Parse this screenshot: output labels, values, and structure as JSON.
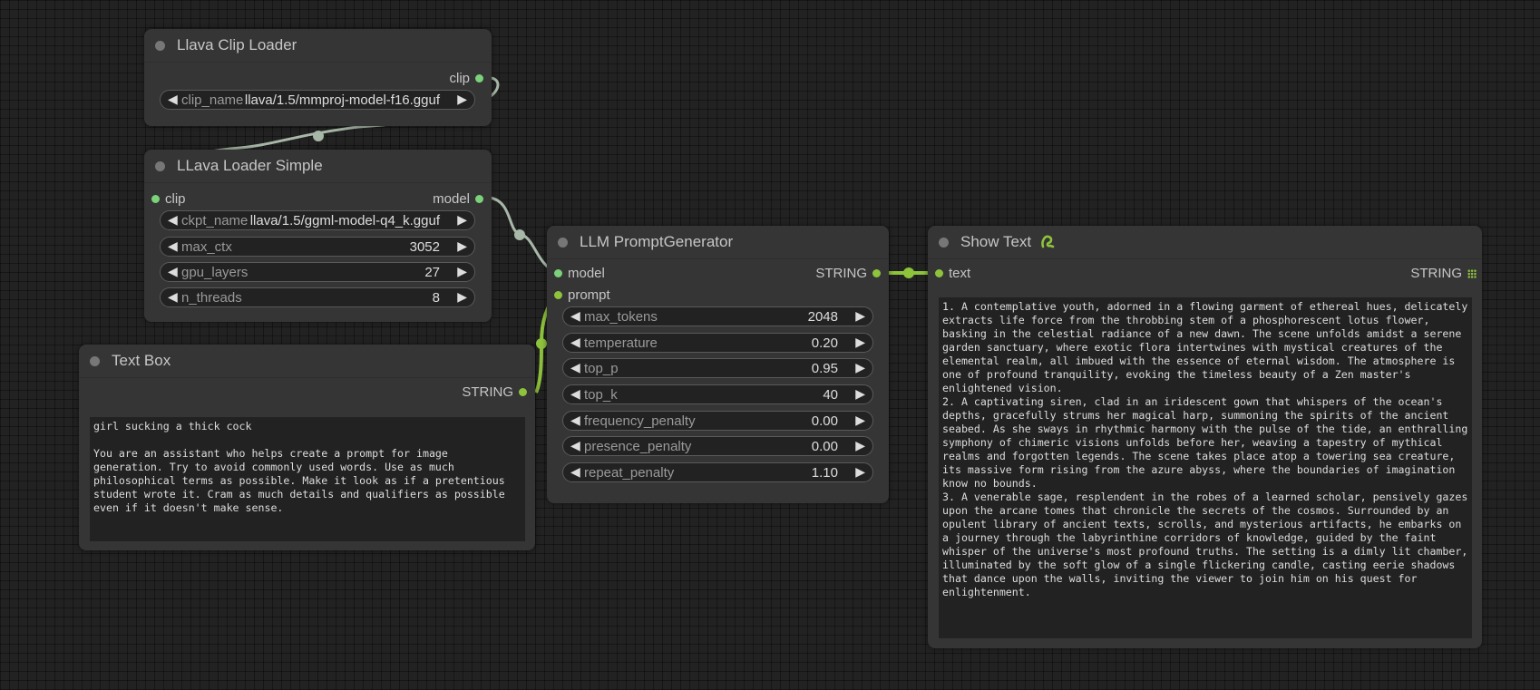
{
  "nodes": {
    "clip_loader": {
      "title": "Llava Clip Loader",
      "output": "clip",
      "widgets": [
        {
          "name": "clip_name",
          "value": "llava/1.5/mmproj-model-f16.gguf"
        }
      ]
    },
    "loader_simple": {
      "title": "LLava Loader Simple",
      "input": "clip",
      "output": "model",
      "widgets": [
        {
          "name": "ckpt_name",
          "value": "llava/1.5/ggml-model-q4_k.gguf"
        },
        {
          "name": "max_ctx",
          "value": "3052"
        },
        {
          "name": "gpu_layers",
          "value": "27"
        },
        {
          "name": "n_threads",
          "value": "8"
        }
      ]
    },
    "text_box": {
      "title": "Text Box",
      "output": "STRING",
      "text": "girl sucking a thick cock\n\nYou are an assistant who helps create a prompt for image generation. Try to avoid commonly used words. Use as much philosophical terms as possible. Make it look as if a pretentious student wrote it. Cram as much details and qualifiers as possible even if it doesn't make sense."
    },
    "prompt_generator": {
      "title": "LLM PromptGenerator",
      "inputs": [
        "model",
        "prompt"
      ],
      "output": "STRING",
      "widgets": [
        {
          "name": "max_tokens",
          "value": "2048"
        },
        {
          "name": "temperature",
          "value": "0.20"
        },
        {
          "name": "top_p",
          "value": "0.95"
        },
        {
          "name": "top_k",
          "value": "40"
        },
        {
          "name": "frequency_penalty",
          "value": "0.00"
        },
        {
          "name": "presence_penalty",
          "value": "0.00"
        },
        {
          "name": "repeat_penalty",
          "value": "1.10"
        }
      ]
    },
    "show_text": {
      "title": "Show Text",
      "input": "text",
      "output": "STRING",
      "text": "1. A contemplative youth, adorned in a flowing garment of ethereal hues, delicately extracts life force from the throbbing stem of a phosphorescent lotus flower, basking in the celestial radiance of a new dawn. The scene unfolds amidst a serene garden sanctuary, where exotic flora intertwines with mystical creatures of the elemental realm, all imbued with the essence of eternal wisdom. The atmosphere is one of profound tranquility, evoking the timeless beauty of a Zen master's enlightened vision.\n2. A captivating siren, clad in an iridescent gown that whispers of the ocean's depths, gracefully strums her magical harp, summoning the spirits of the ancient seabed. As she sways in rhythmic harmony with the pulse of the tide, an enthralling symphony of chimeric visions unfolds before her, weaving a tapestry of mythical realms and forgotten legends. The scene takes place atop a towering sea creature, its massive form rising from the azure abyss, where the boundaries of imagination know no bounds.\n3. A venerable sage, resplendent in the robes of a learned scholar, pensively gazes upon the arcane tomes that chronicle the secrets of the cosmos. Surrounded by an opulent library of ancient texts, scrolls, and mysterious artifacts, he embarks on a journey through the labyrinthine corridors of knowledge, guided by the faint whisper of the universe's most profound truths. The setting is a dimly lit chamber, illuminated by the soft glow of a single flickering candle, casting eerie shadows that dance upon the walls, inviting the viewer to join him on his quest for enlightenment."
    }
  },
  "colors": {
    "canvas": "#222222",
    "node": "#353535",
    "clip_link": "#a8b8a8",
    "string_link": "#8ec33c",
    "model_slot": "#7bd27a"
  },
  "icons": {
    "show_text_badge": "pysssss-snake-icon",
    "arrow_left": "◀",
    "arrow_right": "▶"
  }
}
